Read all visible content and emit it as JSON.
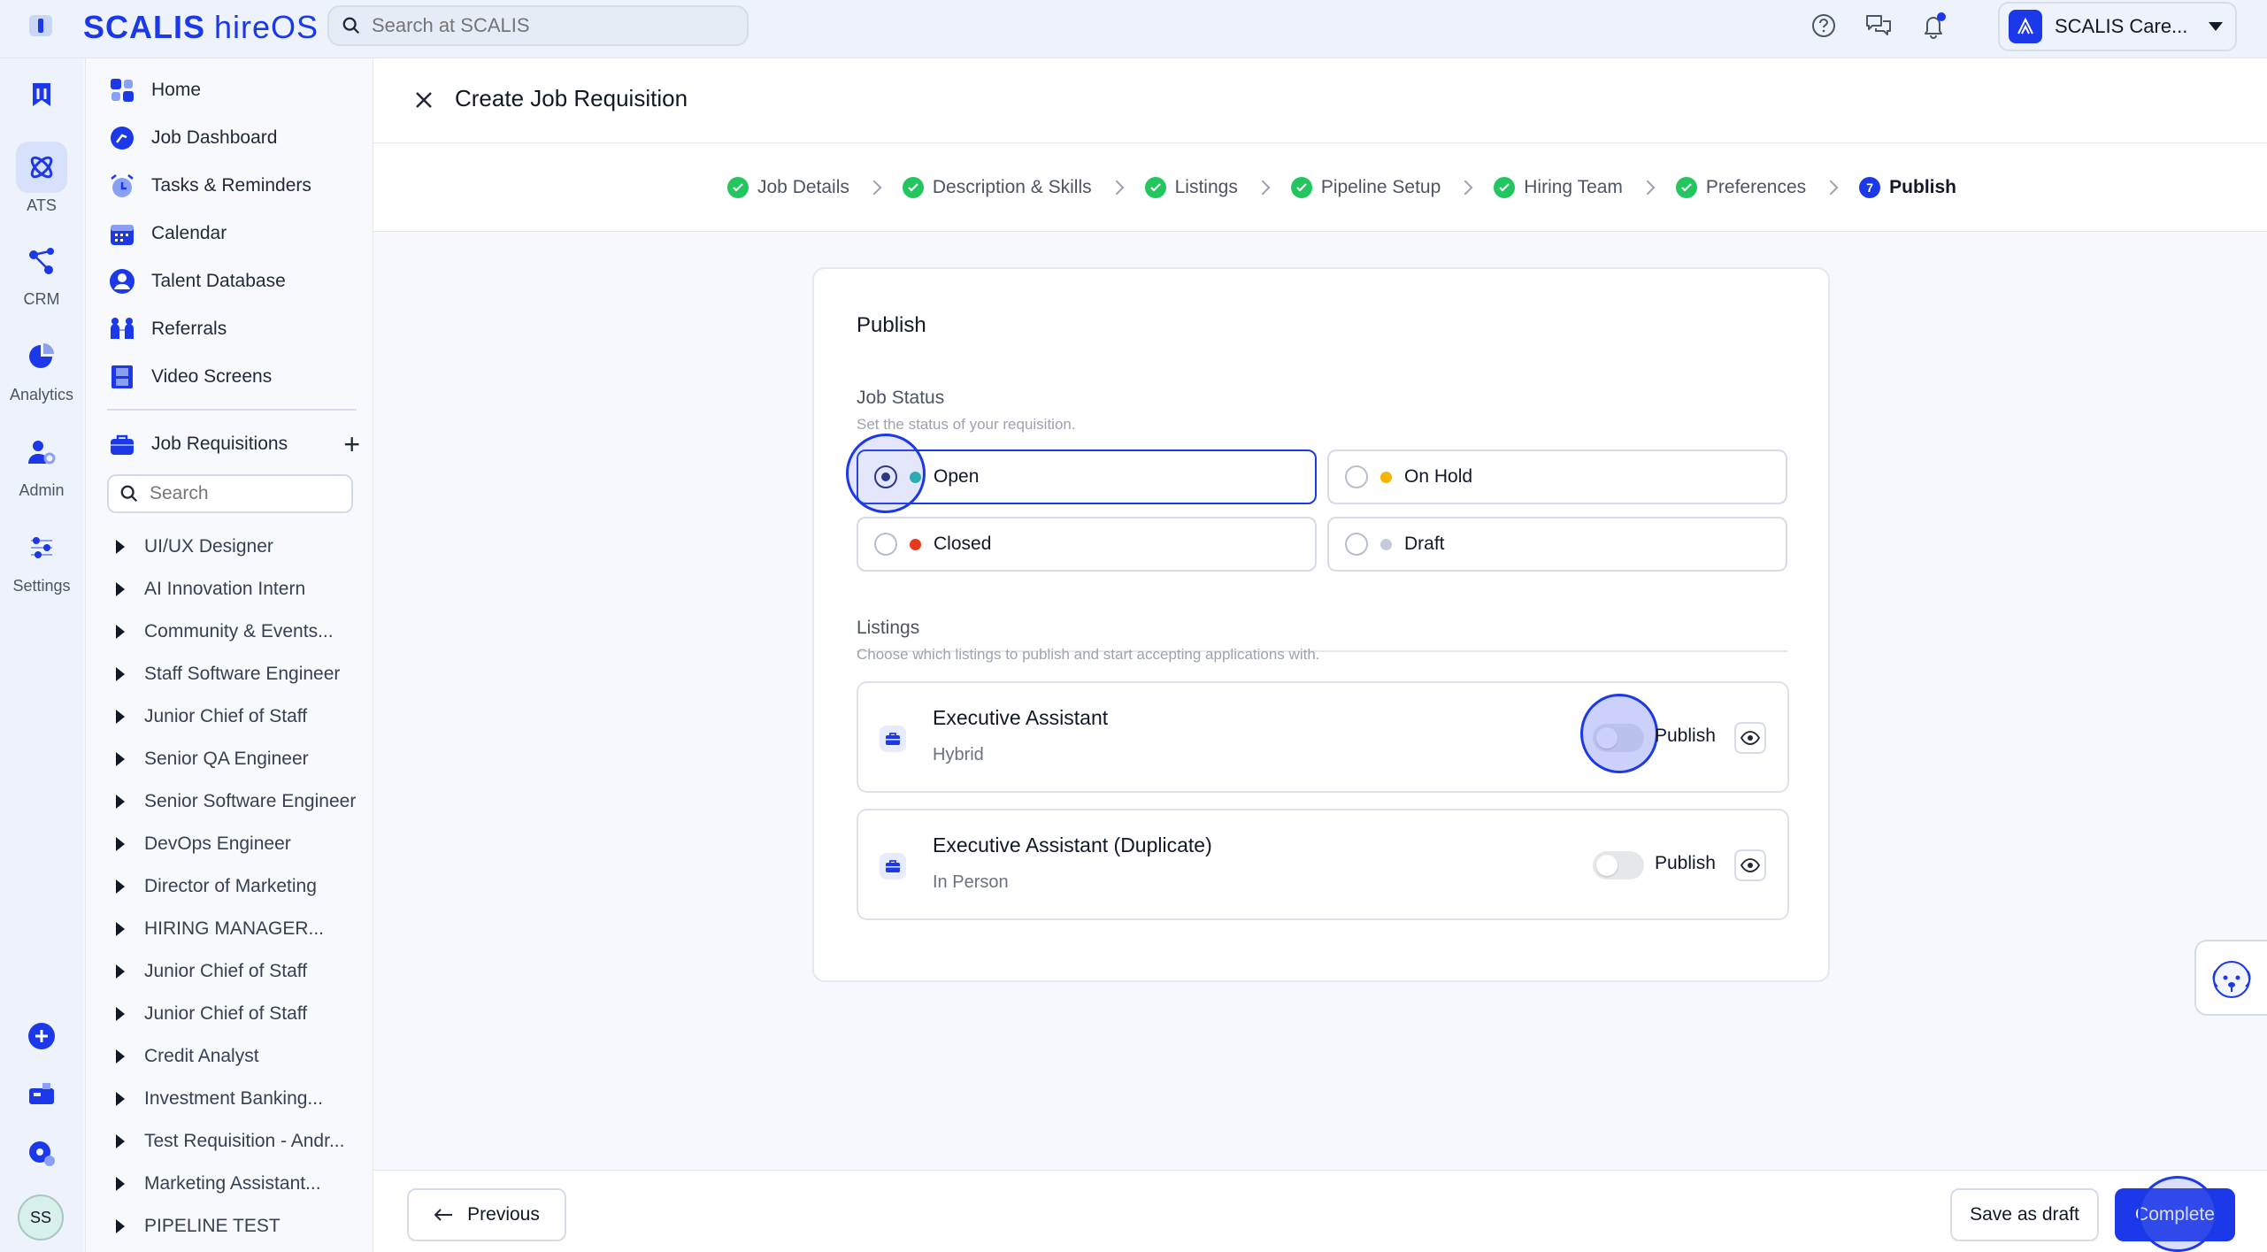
{
  "topbar": {
    "brand_main": "SCALIS",
    "brand_sub": "hireOS",
    "search_placeholder": "Search at SCALIS",
    "account_name": "SCALIS Care..."
  },
  "rail": {
    "items": [
      {
        "label": ""
      },
      {
        "label": "ATS"
      },
      {
        "label": "CRM"
      },
      {
        "label": "Analytics"
      },
      {
        "label": "Admin"
      },
      {
        "label": "Settings"
      }
    ],
    "avatar_initials": "SS"
  },
  "sidebar": {
    "nav": [
      {
        "label": "Home",
        "icon": "home-grid-icon"
      },
      {
        "label": "Job Dashboard",
        "icon": "dashboard-gauge-icon"
      },
      {
        "label": "Tasks & Reminders",
        "icon": "alarm-clock-icon"
      },
      {
        "label": "Calendar",
        "icon": "calendar-icon"
      },
      {
        "label": "Talent Database",
        "icon": "person-circle-icon"
      },
      {
        "label": "Referrals",
        "icon": "referrals-people-icon"
      },
      {
        "label": "Video Screens",
        "icon": "film-strip-icon"
      }
    ],
    "requisitions_label": "Job Requisitions",
    "search_placeholder": "Search",
    "requisitions": [
      "UI/UX Designer",
      "AI Innovation Intern",
      "Community & Events...",
      "Staff Software Engineer",
      "Junior Chief of Staff",
      "Senior QA Engineer",
      "Senior Software Engineer",
      "DevOps Engineer",
      "Director of Marketing",
      "HIRING MANAGER...",
      "Junior Chief of Staff",
      "Junior Chief of Staff",
      "Credit Analyst",
      "Investment Banking...",
      "Test Requisition - Andr...",
      "Marketing Assistant...",
      "PIPELINE TEST"
    ]
  },
  "header": {
    "title": "Create Job Requisition"
  },
  "stepper": {
    "steps": [
      {
        "label": "Job Details",
        "done": true
      },
      {
        "label": "Description & Skills",
        "done": true
      },
      {
        "label": "Listings",
        "done": true
      },
      {
        "label": "Pipeline Setup",
        "done": true
      },
      {
        "label": "Hiring Team",
        "done": true
      },
      {
        "label": "Preferences",
        "done": true
      },
      {
        "label": "Publish",
        "number": "7",
        "done": false
      }
    ]
  },
  "publish": {
    "title": "Publish",
    "job_status_label": "Job Status",
    "job_status_desc": "Set the status of your requisition.",
    "statuses": [
      {
        "label": "Open",
        "color": "#20b7a3",
        "selected": true
      },
      {
        "label": "On Hold",
        "color": "#f5b400",
        "selected": false
      },
      {
        "label": "Closed",
        "color": "#e8391d",
        "selected": false
      },
      {
        "label": "Draft",
        "color": "#c3cbd8",
        "selected": false
      }
    ],
    "listings_label": "Listings",
    "listings_desc": "Choose which listings to publish and start accepting applications with.",
    "listings": [
      {
        "title": "Executive Assistant",
        "subtitle": "Hybrid",
        "publish_label": "Publish",
        "published": false
      },
      {
        "title": "Executive Assistant (Duplicate)",
        "subtitle": "In Person",
        "publish_label": "Publish",
        "published": false
      }
    ]
  },
  "footer": {
    "previous": "Previous",
    "save_draft": "Save as draft",
    "complete": "Complete"
  },
  "colors": {
    "accent": "#1b39e8",
    "success": "#22c55e"
  }
}
